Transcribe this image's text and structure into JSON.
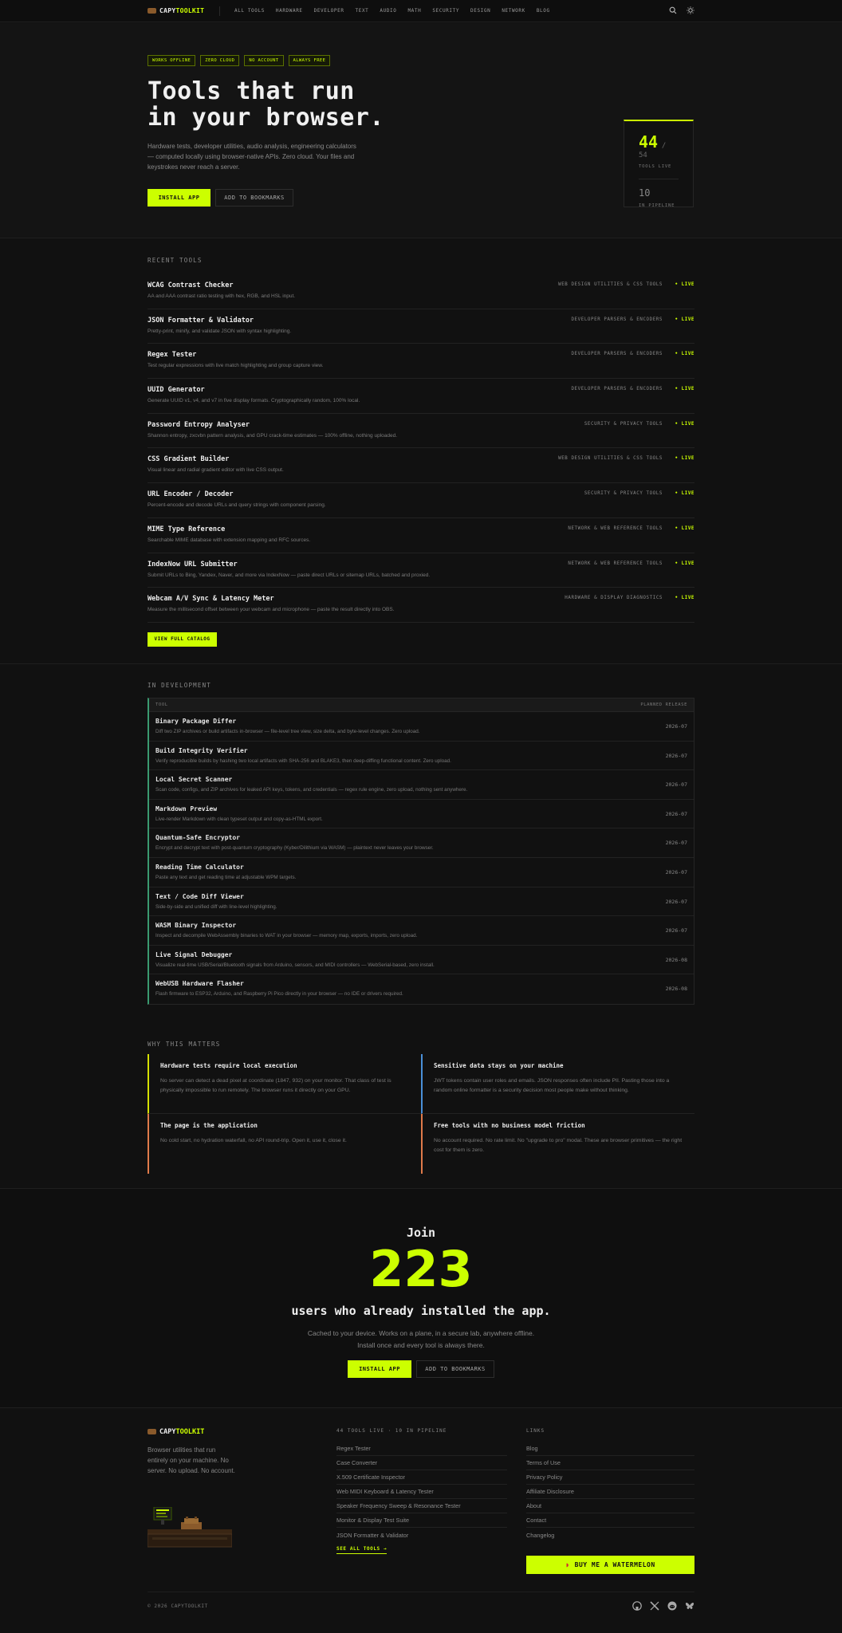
{
  "nav": {
    "logo_a": "CAPY",
    "logo_b": "TOOLKIT",
    "links": [
      "ALL TOOLS",
      "HARDWARE",
      "DEVELOPER",
      "TEXT",
      "AUDIO",
      "MATH",
      "SECURITY",
      "DESIGN",
      "NETWORK",
      "BLOG"
    ]
  },
  "hero": {
    "badges": [
      "WORKS OFFLINE",
      "ZERO CLOUD",
      "NO ACCOUNT",
      "ALWAYS FREE"
    ],
    "title_line1": "Tools that run",
    "title_line2": "in your browser.",
    "lead": "Hardware tests, developer utilities, audio analysis, engineering calculators — computed locally using browser-native APIs. Zero cloud. Your files and keystrokes never reach a server.",
    "install_label": "INSTALL APP",
    "bookmark_label": "ADD TO BOOKMARKS",
    "stats": {
      "live": "44",
      "of": "/ 54",
      "live_label": "TOOLS LIVE",
      "pipeline": "10",
      "pipeline_label": "IN PIPELINE"
    }
  },
  "recent": {
    "title": "RECENT TOOLS",
    "items": [
      {
        "name": "WCAG Contrast Checker",
        "desc": "AA and AAA contrast ratio testing with hex, RGB, and HSL input.",
        "cat": "WEB DESIGN UTILITIES & CSS TOOLS",
        "status": "• LIVE"
      },
      {
        "name": "JSON Formatter & Validator",
        "desc": "Pretty-print, minify, and validate JSON with syntax highlighting.",
        "cat": "DEVELOPER PARSERS & ENCODERS",
        "status": "• LIVE"
      },
      {
        "name": "Regex Tester",
        "desc": "Test regular expressions with live match highlighting and group capture view.",
        "cat": "DEVELOPER PARSERS & ENCODERS",
        "status": "• LIVE"
      },
      {
        "name": "UUID Generator",
        "desc": "Generate UUID v1, v4, and v7 in five display formats. Cryptographically random, 100% local.",
        "cat": "DEVELOPER PARSERS & ENCODERS",
        "status": "• LIVE"
      },
      {
        "name": "Password Entropy Analyser",
        "desc": "Shannon entropy, zxcvbn pattern analysis, and GPU crack-time estimates — 100% offline, nothing uploaded.",
        "cat": "SECURITY & PRIVACY TOOLS",
        "status": "• LIVE"
      },
      {
        "name": "CSS Gradient Builder",
        "desc": "Visual linear and radial gradient editor with live CSS output.",
        "cat": "WEB DESIGN UTILITIES & CSS TOOLS",
        "status": "• LIVE"
      },
      {
        "name": "URL Encoder / Decoder",
        "desc": "Percent-encode and decode URLs and query strings with component parsing.",
        "cat": "SECURITY & PRIVACY TOOLS",
        "status": "• LIVE"
      },
      {
        "name": "MIME Type Reference",
        "desc": "Searchable MIME database with extension mapping and RFC sources.",
        "cat": "NETWORK & WEB REFERENCE TOOLS",
        "status": "• LIVE"
      },
      {
        "name": "IndexNow URL Submitter",
        "desc": "Submit URLs to Bing, Yandex, Naver, and more via IndexNow — paste direct URLs or sitemap URLs, batched and proxied.",
        "cat": "NETWORK & WEB REFERENCE TOOLS",
        "status": "• LIVE"
      },
      {
        "name": "Webcam A/V Sync & Latency Meter",
        "desc": "Measure the millisecond offset between your webcam and microphone — paste the result directly into OBS.",
        "cat": "HARDWARE & DISPLAY DIAGNOSTICS",
        "status": "• LIVE"
      }
    ],
    "catalog_label": "VIEW FULL CATALOG"
  },
  "dev": {
    "title": "IN DEVELOPMENT",
    "col_tool": "TOOL",
    "col_release": "PLANNED RELEASE",
    "items": [
      {
        "name": "Binary Package Differ",
        "desc": "Diff two ZIP archives or build artifacts in-browser — file-level tree view, size delta, and byte-level changes. Zero upload.",
        "date": "2026-07"
      },
      {
        "name": "Build Integrity Verifier",
        "desc": "Verify reproducible builds by hashing two local artifacts with SHA-256 and BLAKE3, then deep-diffing functional content. Zero upload.",
        "date": "2026-07"
      },
      {
        "name": "Local Secret Scanner",
        "desc": "Scan code, configs, and ZIP archives for leaked API keys, tokens, and credentials — regex rule engine, zero upload, nothing sent anywhere.",
        "date": "2026-07"
      },
      {
        "name": "Markdown Preview",
        "desc": "Live-render Markdown with clean typeset output and copy-as-HTML export.",
        "date": "2026-07"
      },
      {
        "name": "Quantum-Safe Encryptor",
        "desc": "Encrypt and decrypt text with post-quantum cryptography (Kyber/Dilithium via WASM) — plaintext never leaves your browser.",
        "date": "2026-07"
      },
      {
        "name": "Reading Time Calculator",
        "desc": "Paste any text and get reading time at adjustable WPM targets.",
        "date": "2026-07"
      },
      {
        "name": "Text / Code Diff Viewer",
        "desc": "Side-by-side and unified diff with line-level highlighting.",
        "date": "2026-07"
      },
      {
        "name": "WASM Binary Inspector",
        "desc": "Inspect and decompile WebAssembly binaries to WAT in your browser — memory map, exports, imports, zero upload.",
        "date": "2026-07"
      },
      {
        "name": "Live Signal Debugger",
        "desc": "Visualize real-time USB/Serial/Bluetooth signals from Arduino, sensors, and MIDI controllers — WebSerial-based, zero install.",
        "date": "2026-08"
      },
      {
        "name": "WebUSB Hardware Flasher",
        "desc": "Flash firmware to ESP32, Arduino, and Raspberry Pi Pico directly in your browser — no IDE or drivers required.",
        "date": "2026-08"
      }
    ]
  },
  "why": {
    "title": "WHY THIS MATTERS",
    "items": [
      {
        "title": "Hardware tests require local execution",
        "desc": "No server can detect a dead pixel at coordinate (1847, 932) on your monitor. That class of test is physically impossible to run remotely. The browser runs it directly on your GPU.",
        "color": "#d4e000"
      },
      {
        "title": "Sensitive data stays on your machine",
        "desc": "JWT tokens contain user roles and emails. JSON responses often include PII. Pasting those into a random online formatter is a security decision most people make without thinking.",
        "color": "#4a90d9"
      },
      {
        "title": "The page is the application",
        "desc": "No cold start, no hydration waterfall, no API round-trip. Open it, use it, close it.",
        "color": "#e07a4a"
      },
      {
        "title": "Free tools with no business model friction",
        "desc": "No account required. No rate limit. No \"upgrade to pro\" modal. These are browser primitives — the right cost for them is zero.",
        "color": "#e07a4a"
      }
    ]
  },
  "join": {
    "pre": "Join",
    "count": "223",
    "post": "users who already installed the app.",
    "sub1": "Cached to your device. Works on a plane, in a secure lab, anywhere offline.",
    "sub2": "Install once and every tool is always there.",
    "install_label": "INSTALL APP",
    "bookmark_label": "ADD TO BOOKMARKS"
  },
  "footer": {
    "logo_a": "CAPY",
    "logo_b": "TOOLKIT",
    "tagline": "Browser utilities that run entirely on your machine. No server. No upload. No account.",
    "tools_head": "44 TOOLS LIVE · 10 IN PIPELINE",
    "tools": [
      "Regex Tester",
      "Case Converter",
      "X.509 Certificate Inspector",
      "Web MIDI Keyboard & Latency Tester",
      "Speaker Frequency Sweep & Resonance Tester",
      "Monitor & Display Test Suite",
      "JSON Formatter & Validator"
    ],
    "see_all": "SEE ALL TOOLS →",
    "links_head": "LINKS",
    "links": [
      "Blog",
      "Terms of Use",
      "Privacy Policy",
      "Affiliate Disclosure",
      "About",
      "Contact",
      "Changelog"
    ],
    "donate": "BUY ME A WATERMELON",
    "copyright": "© 2026 CAPYTOOLKIT"
  }
}
